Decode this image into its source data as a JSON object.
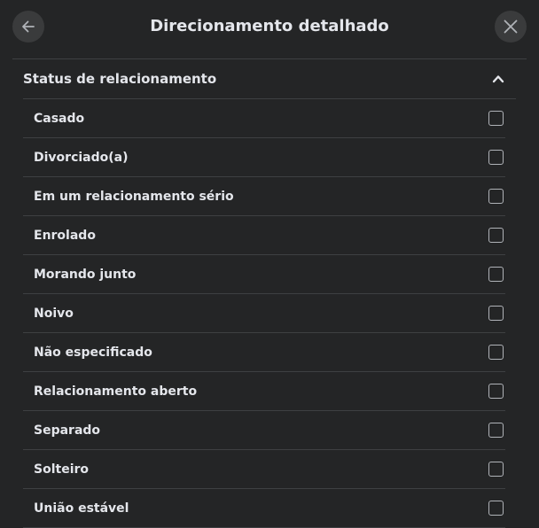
{
  "dialog": {
    "title": "Direcionamento detalhado",
    "back_icon": "arrow-left-icon",
    "close_icon": "close-icon"
  },
  "section": {
    "title": "Status de relacionamento",
    "expanded": true,
    "toggle_icon": "chevron-up-icon",
    "options": [
      {
        "label": "Casado",
        "checked": false
      },
      {
        "label": "Divorciado(a)",
        "checked": false
      },
      {
        "label": "Em um relacionamento sério",
        "checked": false
      },
      {
        "label": "Enrolado",
        "checked": false
      },
      {
        "label": "Morando junto",
        "checked": false
      },
      {
        "label": "Noivo",
        "checked": false
      },
      {
        "label": "Não especificado",
        "checked": false
      },
      {
        "label": "Relacionamento aberto",
        "checked": false
      },
      {
        "label": "Separado",
        "checked": false
      },
      {
        "label": "Solteiro",
        "checked": false
      },
      {
        "label": "União estável",
        "checked": false
      }
    ]
  },
  "colors": {
    "background": "#242526",
    "button_background": "#3a3b3c",
    "divider": "#3e4042",
    "text": "#e4e6eb",
    "icon": "#b0b3b8"
  }
}
